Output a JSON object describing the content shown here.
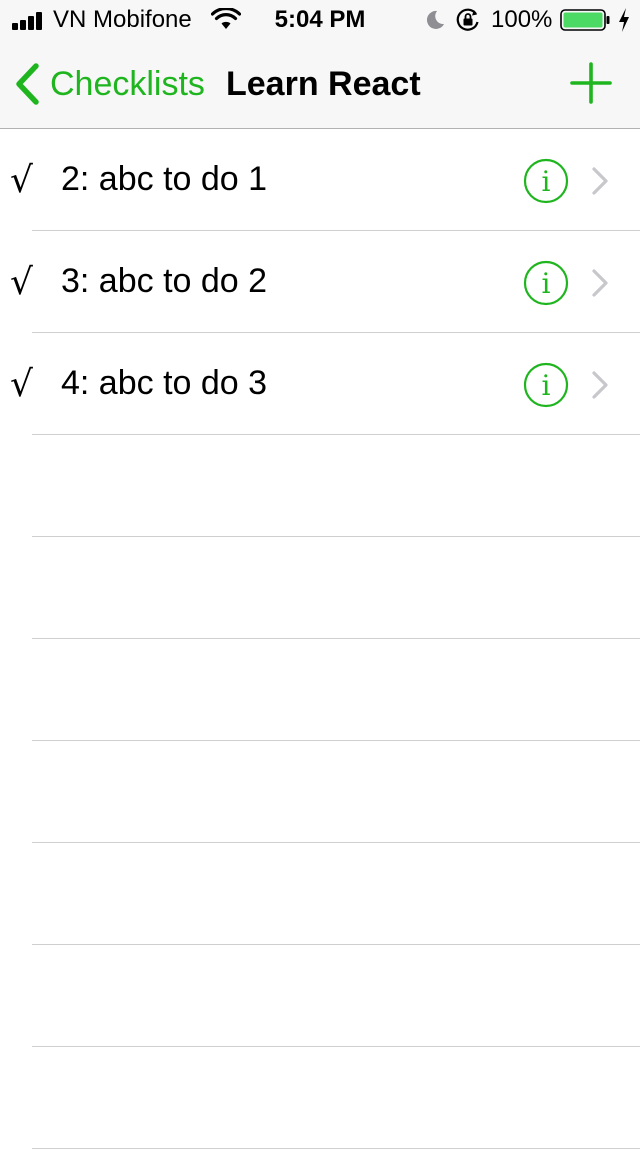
{
  "status_bar": {
    "carrier": "VN Mobifone",
    "time": "5:04 PM",
    "battery_percent": "100%",
    "icons": [
      "signal-icon",
      "wifi-icon",
      "moon-icon",
      "rotation-lock-icon",
      "battery-icon",
      "charging-icon"
    ]
  },
  "nav": {
    "back_label": "Checklists",
    "title": "Learn React",
    "add_icon": "plus-icon"
  },
  "items": [
    {
      "check": "√",
      "label": "2: abc to do 1"
    },
    {
      "check": "√",
      "label": "3: abc to do 2"
    },
    {
      "check": "√",
      "label": "4: abc to do 3"
    }
  ],
  "colors": {
    "accent": "#1fb51f",
    "separator": "#cfcfcf",
    "bar_background": "#f7f7f7",
    "chevron": "#c7c7cc"
  }
}
